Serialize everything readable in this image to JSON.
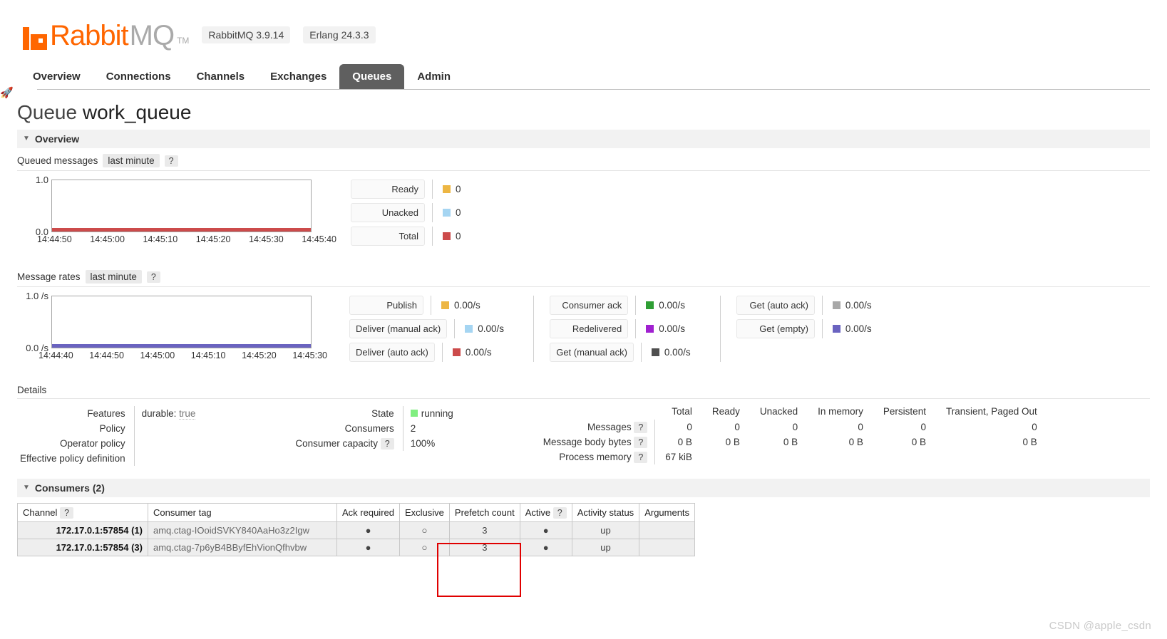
{
  "header": {
    "logo_rabbit": "Rabbit",
    "logo_mq": "MQ",
    "logo_tm": "TM",
    "rabbitmq_version": "RabbitMQ 3.9.14",
    "erlang_version": "Erlang 24.3.3",
    "rocket_icon": "rocket-icon"
  },
  "nav": {
    "items": [
      {
        "label": "Overview",
        "selected": false
      },
      {
        "label": "Connections",
        "selected": false
      },
      {
        "label": "Channels",
        "selected": false
      },
      {
        "label": "Exchanges",
        "selected": false
      },
      {
        "label": "Queues",
        "selected": true
      },
      {
        "label": "Admin",
        "selected": false
      }
    ]
  },
  "page": {
    "title_prefix": "Queue",
    "queue_name": "work_queue",
    "overview_section": "Overview",
    "details_label": "Details",
    "consumers_section": "Consumers (2)"
  },
  "queued_messages": {
    "title": "Queued messages",
    "period": "last minute",
    "help": "?",
    "y_top": "1.0",
    "y_bottom": "0.0",
    "x_ticks": [
      "14:44:50",
      "14:45:00",
      "14:45:10",
      "14:45:20",
      "14:45:30",
      "14:45:40"
    ],
    "legend": [
      {
        "label": "Ready",
        "value": "0",
        "color": "#edb643"
      },
      {
        "label": "Unacked",
        "value": "0",
        "color": "#a5d5f2"
      },
      {
        "label": "Total",
        "value": "0",
        "color": "#cc4b4b"
      }
    ]
  },
  "message_rates": {
    "title": "Message rates",
    "period": "last minute",
    "help": "?",
    "y_top": "1.0 /s",
    "y_bottom": "0.0 /s",
    "x_ticks": [
      "14:44:40",
      "14:44:50",
      "14:45:00",
      "14:45:10",
      "14:45:20",
      "14:45:30"
    ],
    "col1": [
      {
        "label": "Publish",
        "value": "0.00/s",
        "color": "#edb643"
      },
      {
        "label": "Deliver (manual ack)",
        "value": "0.00/s",
        "color": "#a5d5f2"
      },
      {
        "label": "Deliver (auto ack)",
        "value": "0.00/s",
        "color": "#cc4b4b"
      }
    ],
    "col2": [
      {
        "label": "Consumer ack",
        "value": "0.00/s",
        "color": "#2e9e34"
      },
      {
        "label": "Redelivered",
        "value": "0.00/s",
        "color": "#a020d0"
      },
      {
        "label": "Get (manual ack)",
        "value": "0.00/s",
        "color": "#4f4f4f"
      }
    ],
    "col3": [
      {
        "label": "Get (auto ack)",
        "value": "0.00/s",
        "color": "#a8a8a8"
      },
      {
        "label": "Get (empty)",
        "value": "0.00/s",
        "color": "#6a63c0"
      }
    ]
  },
  "details": {
    "left_rows": [
      {
        "label": "Features",
        "value_key": "durable:",
        "value": "true"
      },
      {
        "label": "Policy",
        "value_key": "",
        "value": ""
      },
      {
        "label": "Operator policy",
        "value_key": "",
        "value": ""
      },
      {
        "label": "Effective policy definition",
        "value_key": "",
        "value": ""
      }
    ],
    "mid_rows": [
      {
        "label": "State",
        "value": "running",
        "help": ""
      },
      {
        "label": "Consumers",
        "value": "2",
        "help": ""
      },
      {
        "label": "Consumer capacity",
        "value": "100%",
        "help": "?"
      }
    ],
    "stats_columns": [
      "Total",
      "Ready",
      "Unacked",
      "In memory",
      "Persistent",
      "Transient, Paged Out"
    ],
    "stats_rows": [
      {
        "label": "Messages",
        "help": "?",
        "values": [
          "0",
          "0",
          "0",
          "0",
          "0",
          "0"
        ]
      },
      {
        "label": "Message body bytes",
        "help": "?",
        "values": [
          "0 B",
          "0 B",
          "0 B",
          "0 B",
          "0 B",
          "0 B"
        ]
      },
      {
        "label": "Process memory",
        "help": "?",
        "values": [
          "67 kiB",
          "",
          "",
          "",
          "",
          ""
        ]
      }
    ]
  },
  "consumers_table": {
    "columns": [
      {
        "label": "Channel",
        "help": "?"
      },
      {
        "label": "Consumer tag",
        "help": ""
      },
      {
        "label": "Ack required",
        "help": ""
      },
      {
        "label": "Exclusive",
        "help": ""
      },
      {
        "label": "Prefetch count",
        "help": ""
      },
      {
        "label": "Active",
        "help": "?"
      },
      {
        "label": "Activity status",
        "help": ""
      },
      {
        "label": "Arguments",
        "help": ""
      }
    ],
    "rows": [
      {
        "channel": "172.17.0.1:57854 (1)",
        "consumer_tag": "amq.ctag-IOoidSVKY840AaHo3z2Igw",
        "ack_required": "●",
        "exclusive": "○",
        "prefetch_count": "3",
        "active": "●",
        "activity_status": "up",
        "arguments": ""
      },
      {
        "channel": "172.17.0.1:57854 (3)",
        "consumer_tag": "amq.ctag-7p6yB4BByfEhVionQfhvbw",
        "ack_required": "●",
        "exclusive": "○",
        "prefetch_count": "3",
        "active": "●",
        "activity_status": "up",
        "arguments": ""
      }
    ]
  },
  "annotation": {
    "highlight_color": "#e00000",
    "highlight_target": "Prefetch count"
  },
  "watermark": "CSDN @apple_csdn"
}
